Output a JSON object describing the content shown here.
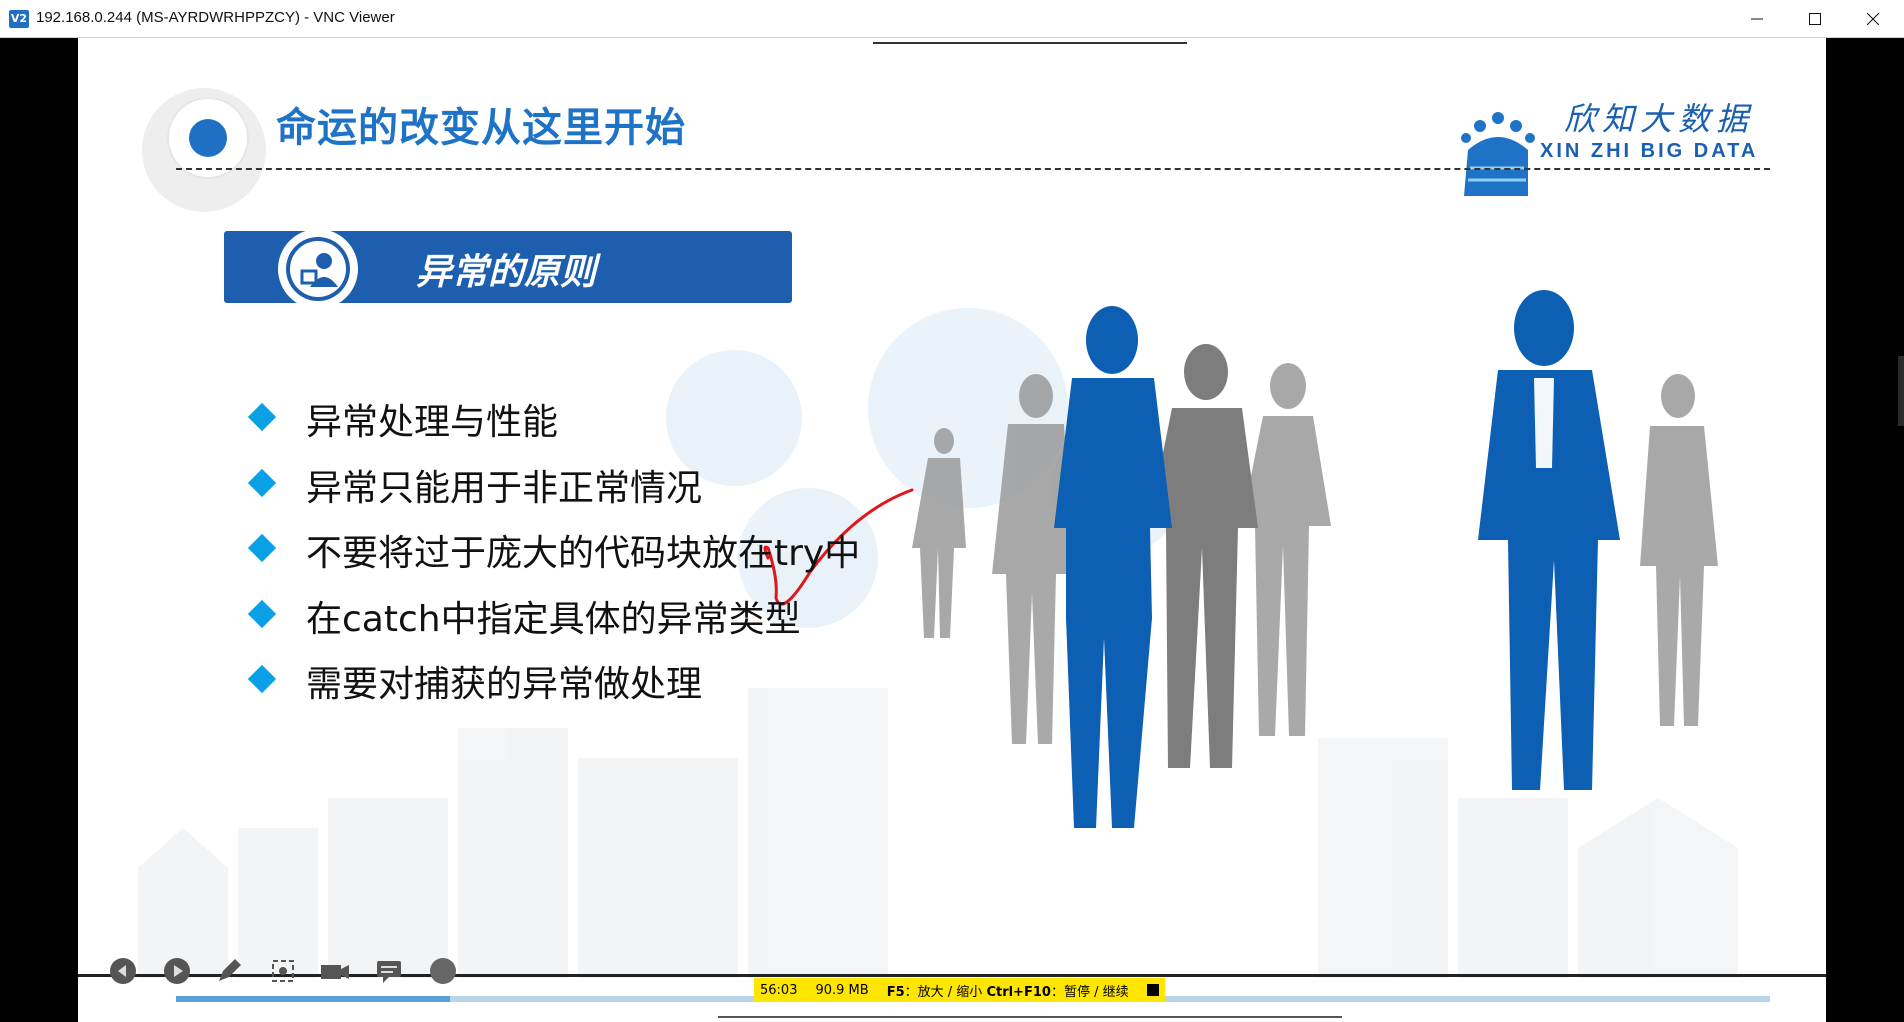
{
  "window": {
    "title": "192.168.0.244 (MS-AYRDWRHPPZCY) - VNC Viewer",
    "app_icon_text": "V2"
  },
  "slide": {
    "title": "命运的改变从这里开始",
    "logo": {
      "cn": "欣知大数据",
      "en": "XIN ZHI BIG DATA"
    },
    "section_label": "异常的原则",
    "bullets": [
      "异常处理与性能",
      "异常只能用于非正常情况",
      "不要将过于庞大的代码块放在try中",
      "在catch中指定具体的异常类型",
      "需要对捕获的异常做处理"
    ],
    "annotation_color": "#e0161a"
  },
  "player": {
    "progress": 0.172,
    "status": {
      "time": "56:03",
      "memory": "90.9 MB",
      "key1": "F5",
      "key1_desc": "放大 / 缩小",
      "key2": "Ctrl+F10",
      "key2_desc": "暂停 / 继续"
    },
    "icons": [
      "back-icon",
      "play-icon",
      "pen-icon",
      "screenshot-icon",
      "camera-icon",
      "comment-icon",
      "record-icon"
    ]
  },
  "colors": {
    "brand_blue": "#1d5fae",
    "title_blue": "#1f73c7",
    "diamond": "#0aa0e6",
    "status_bg": "#ffe600"
  }
}
